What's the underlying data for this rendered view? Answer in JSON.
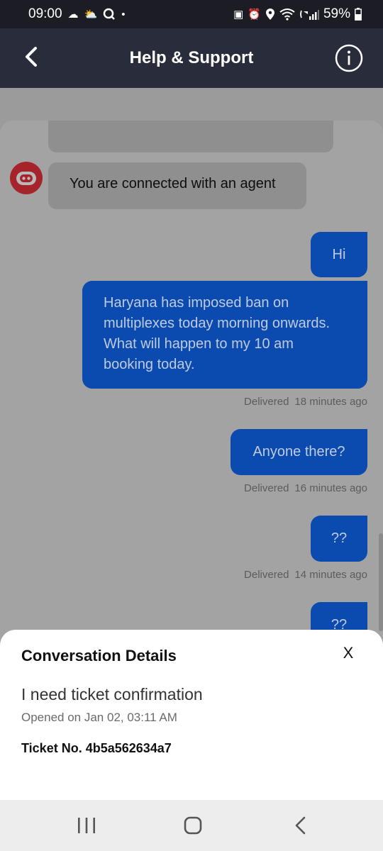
{
  "status_bar": {
    "time": "09:00",
    "battery": "59%"
  },
  "header": {
    "title": "Help & Support"
  },
  "chat": {
    "bot_message": "You are connected with an agent",
    "messages": [
      {
        "text": "Hi"
      },
      {
        "text": "Haryana has imposed ban on multiplexes today morning onwards. What will happen to my 10 am booking today.",
        "status": "Delivered",
        "time": "18 minutes ago"
      },
      {
        "text": "Anyone there?",
        "status": "Delivered",
        "time": "16 minutes ago"
      },
      {
        "text": "??",
        "status": "Delivered",
        "time": "14 minutes ago"
      },
      {
        "text": "??"
      }
    ]
  },
  "sheet": {
    "title": "Conversation Details",
    "close": "X",
    "subject": "I need ticket confirmation",
    "opened": "Opened on Jan 02, 03:11 AM",
    "ticket": "Ticket No. 4b5a562634a7"
  },
  "icons": {
    "bot_avatar": "robot-icon",
    "back": "back-arrow-icon",
    "info": "info-icon"
  },
  "colors": {
    "header_bg": "#292c3b",
    "user_bubble": "#0b4aae",
    "bot_avatar": "#c4202c"
  }
}
